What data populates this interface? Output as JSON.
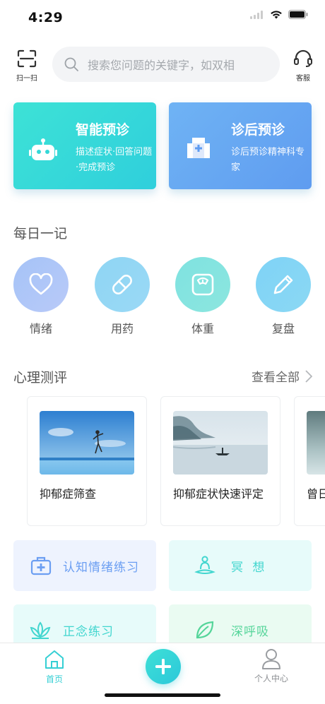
{
  "status_bar": {
    "time": "4:29"
  },
  "header": {
    "scan_label": "扫一扫",
    "search_placeholder": "搜索您问题的关键字，如双相",
    "service_label": "客服"
  },
  "feature_cards": [
    {
      "title": "智能预诊",
      "desc": "描述症状·回答问题·完成预诊",
      "icon": "robot-icon"
    },
    {
      "title": "诊后预诊",
      "desc": "诊后预诊精神科专家",
      "icon": "hospital-icon"
    }
  ],
  "daily": {
    "title": "每日一记",
    "items": [
      {
        "label": "情绪",
        "icon": "heart-icon"
      },
      {
        "label": "用药",
        "icon": "pill-icon"
      },
      {
        "label": "体重",
        "icon": "scale-icon"
      },
      {
        "label": "复盘",
        "icon": "pencil-icon"
      }
    ]
  },
  "psych": {
    "title": "心理测评",
    "view_all": "查看全部",
    "cards": [
      {
        "label": "抑郁症筛查"
      },
      {
        "label": "抑郁症状快速评定"
      },
      {
        "label": "曾日"
      }
    ]
  },
  "tiles": [
    {
      "label": "认知情绪练习",
      "icon": "medkit-icon"
    },
    {
      "label": "冥  想",
      "icon": "meditation-icon"
    },
    {
      "label": "正念练习",
      "icon": "lotus-icon"
    },
    {
      "label": "深呼吸",
      "icon": "leaf-icon"
    }
  ],
  "tabbar": {
    "home": "首页",
    "profile": "个人中心"
  },
  "colors": {
    "accent": "#2fd2d8",
    "blue": "#5f9cf0"
  }
}
